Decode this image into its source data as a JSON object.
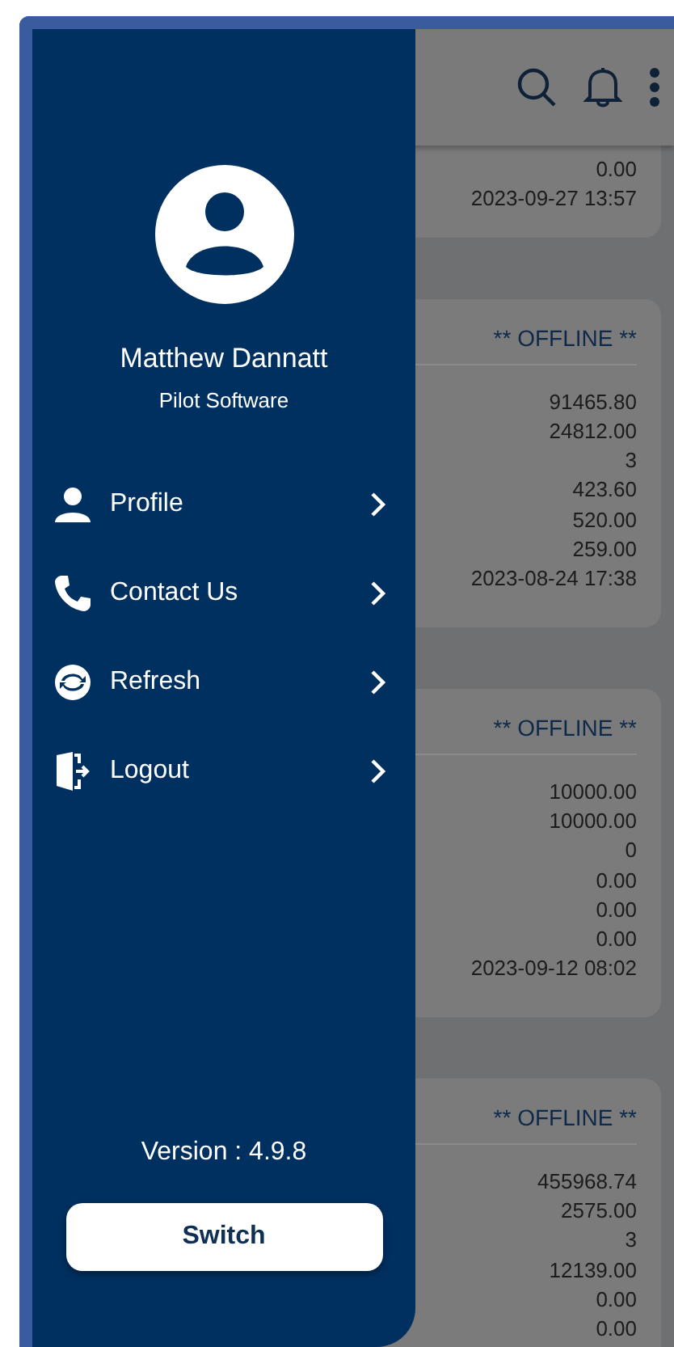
{
  "drawer": {
    "user": {
      "name": "Matthew Dannatt",
      "company": "Pilot Software"
    },
    "menu": [
      {
        "kind": "profile",
        "label": "Profile"
      },
      {
        "kind": "contact",
        "label": "Contact Us"
      },
      {
        "kind": "refresh",
        "label": "Refresh"
      },
      {
        "kind": "logout",
        "label": "Logout"
      }
    ],
    "version": "Version : 4.9.8",
    "switch_button": "Switch"
  },
  "cards": [
    {
      "values": [
        "0.00",
        "2023-09-27 13:57"
      ]
    },
    {
      "header": "** OFFLINE **",
      "values": [
        "91465.80",
        "24812.00",
        "3",
        "423.60",
        "520.00",
        "259.00",
        "2023-08-24 17:38"
      ]
    },
    {
      "header": "** OFFLINE **",
      "values": [
        "10000.00",
        "10000.00",
        "0",
        "0.00",
        "0.00",
        "0.00",
        "2023-09-12 08:02"
      ]
    },
    {
      "header": "** OFFLINE **",
      "values": [
        "455968.74",
        "2575.00",
        "3",
        "12139.00",
        "0.00",
        "0.00"
      ]
    }
  ]
}
